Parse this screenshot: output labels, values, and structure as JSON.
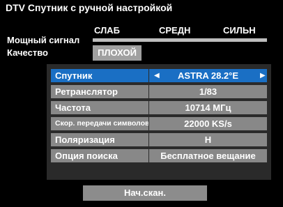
{
  "header": {
    "title": "DTV Спутник с ручной настройкой"
  },
  "signal": {
    "label": "Мощный сигнал",
    "levels": [
      "СЛАБ",
      "СРЕДН",
      "СИЛЬН"
    ]
  },
  "quality": {
    "label": "Качество",
    "value": "ПЛОХОЙ"
  },
  "settings": [
    {
      "label": "Спутник",
      "value": "ASTRA 28.2°E",
      "selected": true
    },
    {
      "label": "Ретранслятор",
      "value": "1/83"
    },
    {
      "label": "Частота",
      "value": "10714 МГц"
    },
    {
      "label": "Скор. передачи символов",
      "value": "22000 KS/s"
    },
    {
      "label": "Поляризация",
      "value": "H"
    },
    {
      "label": "Опция поиска",
      "value": "Бесплатное вещание"
    }
  ],
  "footer": {
    "start_label": "Нач.скан."
  },
  "colors": {
    "selected_row": "#1a6fc4",
    "normal_row": "#888888",
    "panel": "#2a2a2a",
    "background": "#000000"
  }
}
